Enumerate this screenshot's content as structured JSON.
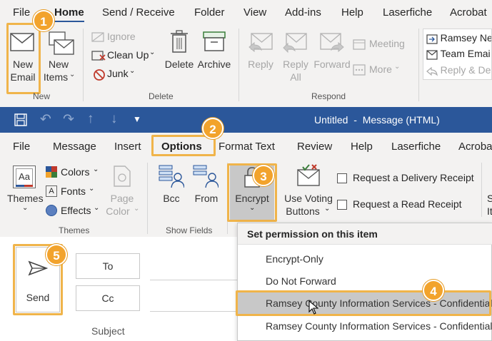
{
  "top_ribbon": {
    "tabs": [
      "File",
      "Home",
      "Send / Receive",
      "Folder",
      "View",
      "Add-ins",
      "Help",
      "Laserfiche",
      "Acrobat"
    ],
    "active_tab": "Home",
    "new_group": {
      "new_email": [
        "New",
        "Email"
      ],
      "new_items": [
        "New",
        "Items"
      ],
      "label": "New"
    },
    "delete_group": {
      "ignore": "Ignore",
      "clean_up": "Clean Up",
      "junk": "Junk",
      "delete": "Delete",
      "archive": "Archive",
      "label": "Delete"
    },
    "respond_group": {
      "reply": "Reply",
      "reply_all": [
        "Reply",
        "All"
      ],
      "forward": "Forward",
      "meeting": "Meeting",
      "more": "More",
      "label": "Respond"
    },
    "quick_steps": [
      "Ramsey Ne",
      "Team Emai",
      "Reply & De"
    ]
  },
  "message_window": {
    "title": "Untitled  -  Message (HTML)",
    "tabs": [
      "File",
      "Message",
      "Insert",
      "Options",
      "Format Text",
      "Review",
      "Help",
      "Laserfiche",
      "Acroba"
    ],
    "active_tab": "Options",
    "themes_group": {
      "themes": "Themes",
      "colors": "Colors",
      "fonts": "Fonts",
      "effects": "Effects",
      "page_color": [
        "Page",
        "Color"
      ],
      "label": "Themes"
    },
    "show_fields_group": {
      "bcc": "Bcc",
      "from": "From",
      "label": "Show Fields"
    },
    "encrypt": "Encrypt",
    "tracking": {
      "voting": [
        "Use Voting",
        "Buttons"
      ],
      "delivery_receipt": "Request a Delivery Receipt",
      "read_receipt": "Request a Read Receipt",
      "cut_label": [
        "S",
        "It"
      ]
    },
    "compose": {
      "send": "Send",
      "to": "To",
      "cc": "Cc",
      "subject": "Subject"
    }
  },
  "encrypt_menu": {
    "header": "Set permission on this item",
    "items": [
      "Encrypt-Only",
      "Do Not Forward",
      "Ramsey County Information Services - Confidential",
      "Ramsey County Information Services - Confidential V"
    ],
    "selected_index": 2
  },
  "steps": [
    "1",
    "2",
    "3",
    "4",
    "5"
  ],
  "colors": {
    "accent_blue": "#2b579a",
    "callout": "#f2a32c",
    "highlight": "#c8c8c8"
  }
}
